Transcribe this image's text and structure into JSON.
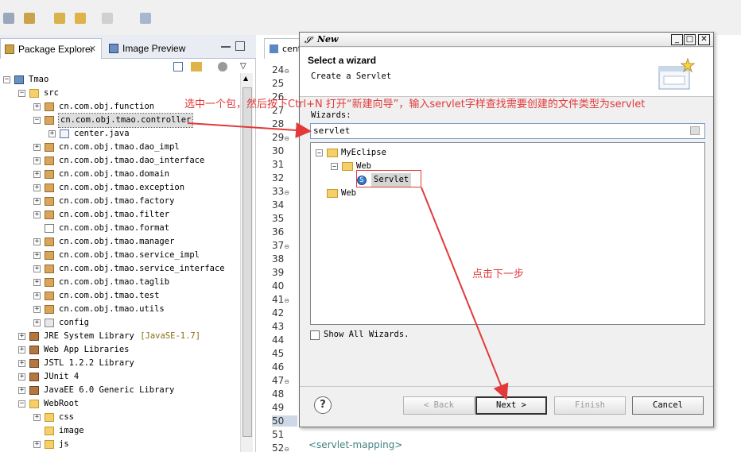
{
  "explorer": {
    "tabs": [
      {
        "label": "Package Explorer",
        "close": "✕"
      },
      {
        "label": "Image Preview"
      }
    ],
    "tree": [
      {
        "label": "Tmao",
        "icon": "project-icon",
        "toggle": "−",
        "indent": 0
      },
      {
        "label": "src",
        "icon": "source-folder-icon",
        "toggle": "−",
        "indent": 1
      },
      {
        "label": "cn.com.obj.function",
        "icon": "package-icon",
        "toggle": "+",
        "indent": 2
      },
      {
        "label": "cn.com.obj.tmao.controller",
        "icon": "package-icon",
        "toggle": "−",
        "indent": 2,
        "selected": true
      },
      {
        "label": "center.java",
        "icon": "java-file-icon",
        "toggle": "+",
        "indent": 3
      },
      {
        "label": "cn.com.obj.tmao.dao_impl",
        "icon": "package-icon",
        "toggle": "+",
        "indent": 2
      },
      {
        "label": "cn.com.obj.tmao.dao_interface",
        "icon": "package-icon",
        "toggle": "+",
        "indent": 2
      },
      {
        "label": "cn.com.obj.tmao.domain",
        "icon": "package-icon",
        "toggle": "+",
        "indent": 2
      },
      {
        "label": "cn.com.obj.tmao.exception",
        "icon": "package-icon",
        "toggle": "+",
        "indent": 2
      },
      {
        "label": "cn.com.obj.tmao.factory",
        "icon": "package-icon",
        "toggle": "+",
        "indent": 2
      },
      {
        "label": "cn.com.obj.tmao.filter",
        "icon": "package-icon",
        "toggle": "+",
        "indent": 2
      },
      {
        "label": "cn.com.obj.tmao.format",
        "icon": "empty-package-icon",
        "toggle": "",
        "indent": 2
      },
      {
        "label": "cn.com.obj.tmao.manager",
        "icon": "package-icon",
        "toggle": "+",
        "indent": 2
      },
      {
        "label": "cn.com.obj.tmao.service_impl",
        "icon": "package-icon",
        "toggle": "+",
        "indent": 2
      },
      {
        "label": "cn.com.obj.tmao.service_interface",
        "icon": "package-icon",
        "toggle": "+",
        "indent": 2
      },
      {
        "label": "cn.com.obj.tmao.taglib",
        "icon": "package-icon",
        "toggle": "+",
        "indent": 2
      },
      {
        "label": "cn.com.obj.tmao.test",
        "icon": "package-icon",
        "toggle": "+",
        "indent": 2
      },
      {
        "label": "cn.com.obj.tmao.utils",
        "icon": "package-icon",
        "toggle": "+",
        "indent": 2
      },
      {
        "label": "config",
        "icon": "config-package-icon",
        "toggle": "+",
        "indent": 2
      },
      {
        "label": "JRE System Library",
        "suffix": "[JavaSE-1.7]",
        "icon": "library-icon",
        "toggle": "+",
        "indent": 1
      },
      {
        "label": "Web App Libraries",
        "icon": "library-icon",
        "toggle": "+",
        "indent": 1
      },
      {
        "label": "JSTL 1.2.2 Library",
        "icon": "library-icon",
        "toggle": "+",
        "indent": 1
      },
      {
        "label": "JUnit 4",
        "icon": "library-icon",
        "toggle": "+",
        "indent": 1
      },
      {
        "label": "JavaEE 6.0 Generic Library",
        "icon": "library-icon",
        "toggle": "+",
        "indent": 1
      },
      {
        "label": "WebRoot",
        "icon": "folder-icon",
        "toggle": "−",
        "indent": 1
      },
      {
        "label": "css",
        "icon": "folder-icon",
        "toggle": "+",
        "indent": 2
      },
      {
        "label": "image",
        "icon": "folder-icon",
        "toggle": "",
        "indent": 2
      },
      {
        "label": "js",
        "icon": "folder-icon",
        "toggle": "+",
        "indent": 2
      }
    ]
  },
  "editor": {
    "tab_label": "cent",
    "line_numbers": [
      {
        "n": "24",
        "fold": true
      },
      {
        "n": "25"
      },
      {
        "n": "26"
      },
      {
        "n": "27"
      },
      {
        "n": "28"
      },
      {
        "n": "29",
        "fold": true
      },
      {
        "n": "30"
      },
      {
        "n": "31"
      },
      {
        "n": "32"
      },
      {
        "n": "33",
        "fold": true
      },
      {
        "n": "34"
      },
      {
        "n": "35"
      },
      {
        "n": "36"
      },
      {
        "n": "37",
        "fold": true
      },
      {
        "n": "38"
      },
      {
        "n": "39"
      },
      {
        "n": "40"
      },
      {
        "n": "41",
        "fold": true
      },
      {
        "n": "42"
      },
      {
        "n": "43"
      },
      {
        "n": "44"
      },
      {
        "n": "45"
      },
      {
        "n": "46"
      },
      {
        "n": "47",
        "fold": true
      },
      {
        "n": "48"
      },
      {
        "n": "49"
      },
      {
        "n": "50"
      },
      {
        "n": "51"
      },
      {
        "n": "52",
        "fold": true
      }
    ],
    "code_snippet": "<servlet-mapping>"
  },
  "dialog": {
    "title": "New",
    "heading": "Select a wizard",
    "subheading": "Create a Servlet",
    "wizards_label": "Wizards:",
    "filter_value": "servlet",
    "wizard_tree": [
      {
        "label": "MyEclipse",
        "toggle": "−",
        "indent": 0,
        "icon": "folder-open-icon"
      },
      {
        "label": "Web",
        "toggle": "−",
        "indent": 1,
        "icon": "folder-open-icon"
      },
      {
        "label": "Servlet",
        "toggle": "",
        "indent": 2,
        "icon": "servlet-icon",
        "selected": true
      },
      {
        "label": "Web",
        "toggle": "",
        "indent": 0,
        "icon": "folder-open-icon"
      }
    ],
    "show_all_label": "Show All Wizards.",
    "buttons": {
      "help": "?",
      "back": "< Back",
      "next": "Next >",
      "finish": "Finish",
      "cancel": "Cancel"
    },
    "window_buttons": {
      "minimize": "_",
      "maximize": "□",
      "close": "✕"
    }
  },
  "annotations": {
    "instruction": "选中一个包，然后按下Ctrl+N 打开“新建向导”，输入servlet字样查找需要创建的文件类型为servlet",
    "click_next": "点击下一步",
    "color": "#e23a3a"
  }
}
